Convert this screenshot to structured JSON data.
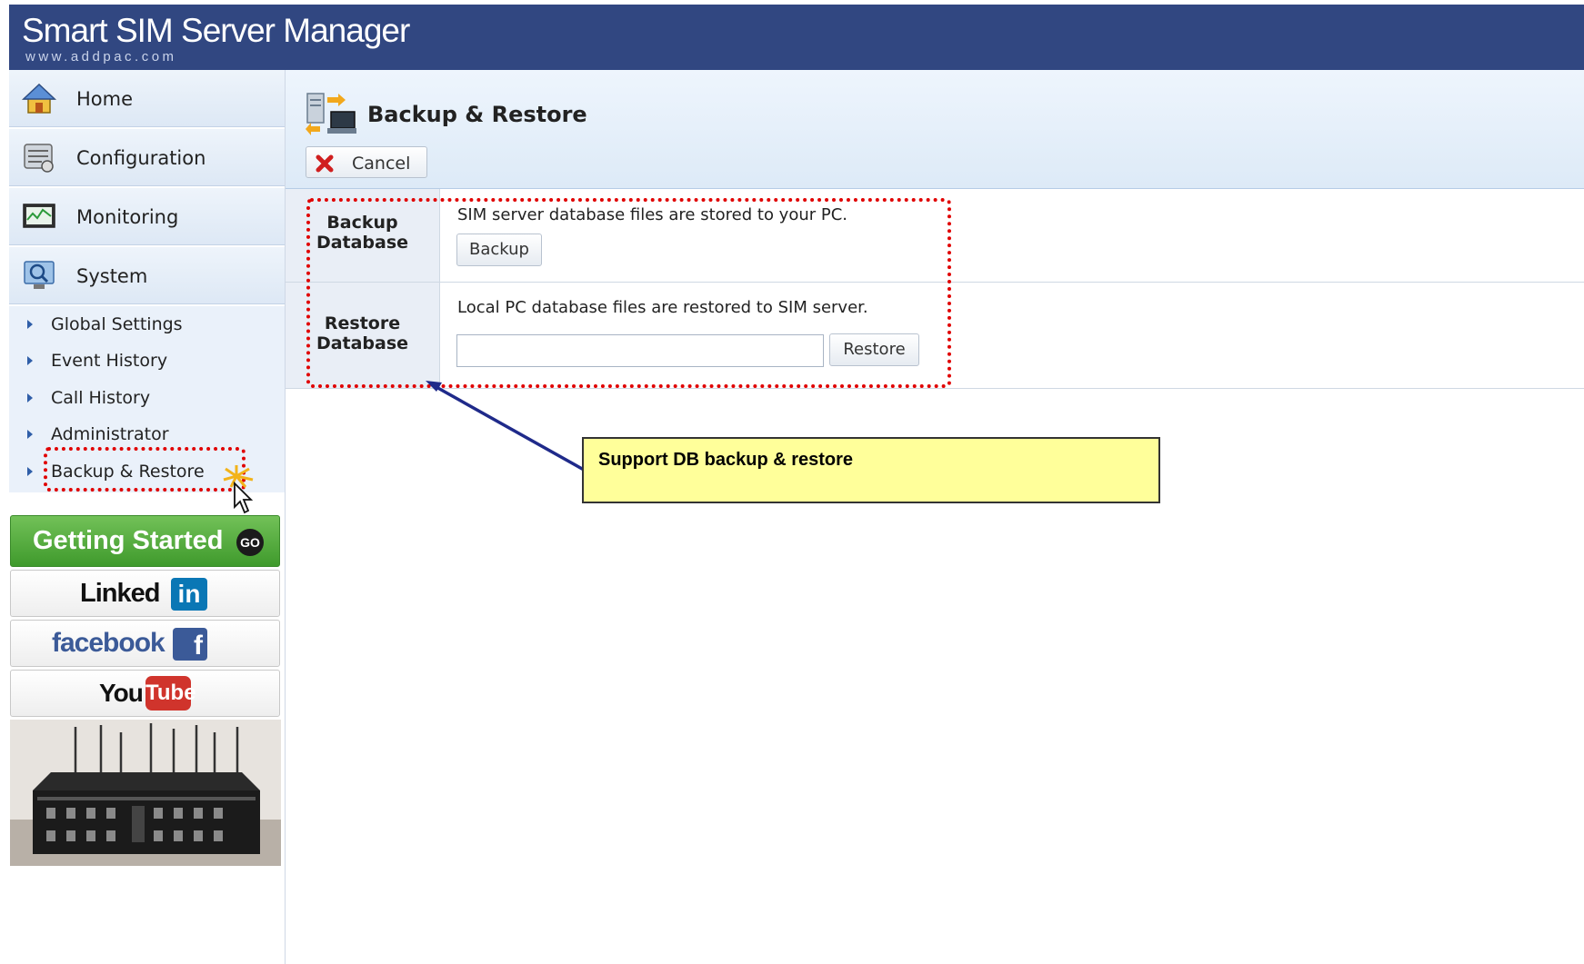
{
  "header": {
    "title": "Smart SIM Server Manager",
    "url": "www.addpac.com",
    "color": "#314781"
  },
  "sidebar": {
    "nav": [
      {
        "label": "Home",
        "icon": "home-icon"
      },
      {
        "label": "Configuration",
        "icon": "configuration-icon"
      },
      {
        "label": "Monitoring",
        "icon": "monitoring-icon"
      },
      {
        "label": "System",
        "icon": "system-icon"
      }
    ],
    "submenu": [
      {
        "label": "Global Settings"
      },
      {
        "label": "Event History"
      },
      {
        "label": "Call History"
      },
      {
        "label": "Administrator"
      },
      {
        "label": "Backup & Restore"
      }
    ],
    "promos": {
      "getting_started": "Getting Started",
      "go": "GO",
      "linkedin_text": "Linked",
      "linkedin_badge": "in",
      "facebook_text": "facebook",
      "facebook_badge": "f",
      "youtube_text": "You",
      "youtube_badge": "Tube"
    }
  },
  "main": {
    "title": "Backup & Restore",
    "cancel_label": "Cancel",
    "rows": [
      {
        "label_line1": "Backup",
        "label_line2": "Database",
        "description": "SIM server database files are stored to your PC.",
        "button": "Backup"
      },
      {
        "label_line1": "Restore",
        "label_line2": "Database",
        "description": "Local PC database files are restored to SIM server.",
        "input_value": "",
        "button": "Restore"
      }
    ]
  },
  "annotation": {
    "callout": "Support DB backup & restore",
    "highlight_color": "#e00000",
    "callout_color": "#ffff9a"
  }
}
